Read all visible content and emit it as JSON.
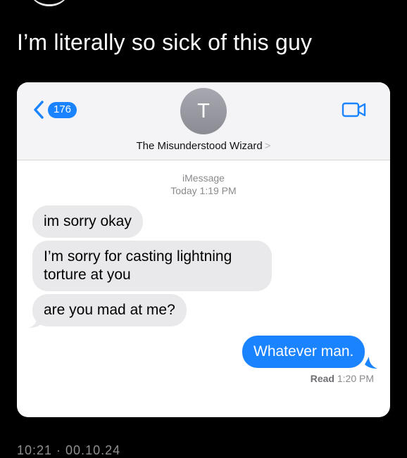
{
  "tweet": {
    "text": "I’m literally so sick of this guy",
    "footer_fragment": "10:21 · 00.10.24"
  },
  "imessage": {
    "back_count": "176",
    "avatar_initial": "T",
    "contact_name": "The Misunderstood Wizard",
    "name_chevron": ">",
    "service_label": "iMessage",
    "timestamp": "Today 1:19 PM",
    "messages": [
      {
        "direction": "incoming",
        "text": "im sorry okay"
      },
      {
        "direction": "incoming",
        "text": "I’m sorry for casting lightning torture at you"
      },
      {
        "direction": "incoming",
        "text": "are you mad at me?"
      },
      {
        "direction": "outgoing",
        "text": "Whatever man."
      }
    ],
    "read_label": "Read",
    "read_time": "1:20 PM"
  },
  "colors": {
    "background": "#000000",
    "card": "#ffffff",
    "header": "#f4f4f6",
    "accent_blue": "#1a83ff",
    "incoming_bubble": "#e9e9eb"
  },
  "icons": [
    "back-chevron-icon",
    "video-camera-icon",
    "chevron-right-icon"
  ]
}
